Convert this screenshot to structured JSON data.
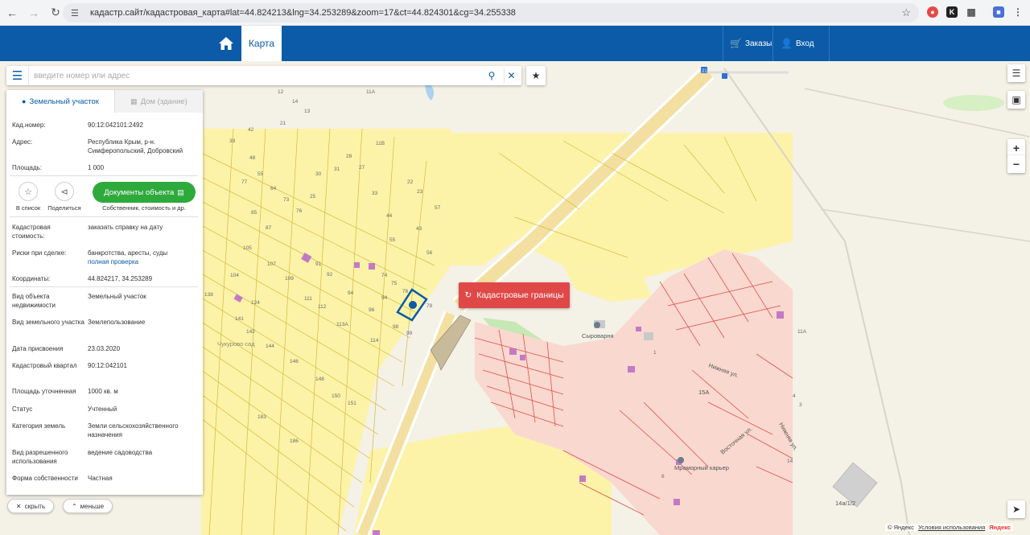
{
  "browser": {
    "url": "кадастр.сайт/кадастровая_карта#lat=44.824213&lng=34.253289&zoom=17&ct=44.824301&cg=34.255338"
  },
  "header": {
    "map_tab": "Карта",
    "orders": "Заказы",
    "login": "Вход"
  },
  "search": {
    "placeholder": "введите номер или адрес"
  },
  "panel": {
    "tab_land": "Земельный участок",
    "tab_house": "Дом (здание)",
    "cadnum_label": "Кад.номер:",
    "cadnum_value": "90:12:042101:2492",
    "address_label": "Адрес:",
    "address_value": "Республика Крым, р-н. Симферопольский, Добровский",
    "area_label": "Площадь:",
    "area_value": "1 000",
    "to_list": "В список",
    "share": "Поделиться",
    "docs_button": "Документы объекта",
    "docs_sub": "Собственник, стоимость и др.",
    "cost_label": "Кадастровая стоимость:",
    "cost_value": "заказать справку на дату",
    "risks_label": "Риски при сделке:",
    "risks_value": "банкротства, аресты, суды",
    "risks_link": "полная проверка",
    "coords_label": "Координаты:",
    "coords_value": "44.824217, 34.253289",
    "obj_type_label": "Вид объекта недвижимости",
    "obj_type_value": "Земельный участок",
    "land_type_label": "Вид земельного участка",
    "land_type_value": "Землепользование",
    "date_label": "Дата присвоения",
    "date_value": "23.03.2020",
    "quarter_label": "Кадастровый квартал",
    "quarter_value": "90:12:042101",
    "area_spec_label": "Площадь уточненная",
    "area_spec_value": "1000 кв. м",
    "status_label": "Статус",
    "status_value": "Учтенный",
    "category_label": "Категория земель",
    "category_value": "Земли сельскохозяйственного назначения",
    "use_label": "Вид разрешенного использования",
    "use_value": "ведение садоводства",
    "ownership_label": "Форма собственности",
    "ownership_value": "Частная"
  },
  "bottom": {
    "hide": "скрыть",
    "less": "меньше"
  },
  "map": {
    "cadastral_button": "Кадастровые границы",
    "labels": {
      "garden": "Чукурово сад",
      "cheese": "Сыроварня",
      "quarry": "Мраморный карьер",
      "street1": "Нижняя ул.",
      "street2": "Нижняя ул.",
      "street3": "Восточная ул.",
      "lot_11a": "11А",
      "lot_15a": "15А",
      "lot_14a": "14а/1/2",
      "road_num": "21"
    }
  },
  "attribution": {
    "copy": "© Яндекс",
    "terms": "Условия использования",
    "brand": "Яндекс"
  },
  "colors": {
    "brand_blue": "#0b5ba8",
    "docs_green": "#2eaa3d",
    "cad_red": "#e04848",
    "parcel_yellow": "#fcf3a8",
    "parcel_red": "#f8d6cc"
  }
}
